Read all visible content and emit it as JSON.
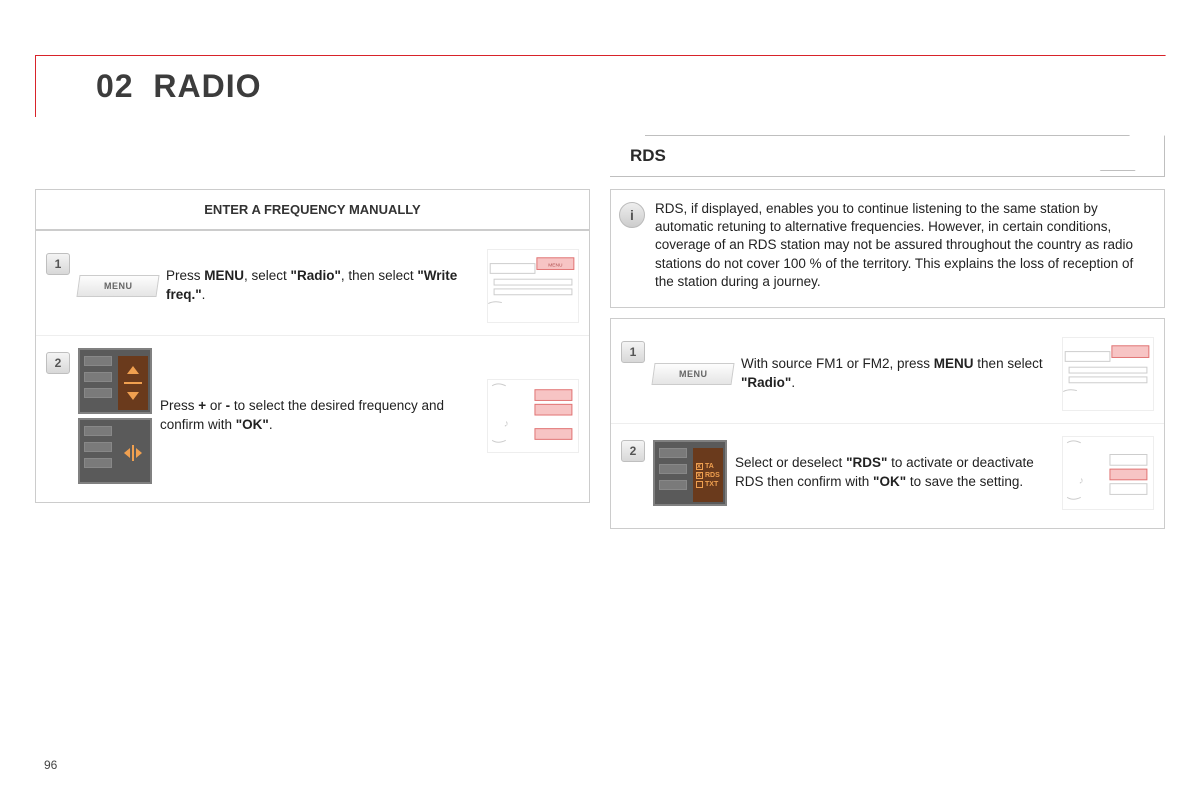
{
  "page": {
    "section_number": "02",
    "section_title": "RADIO",
    "page_number": "96"
  },
  "left": {
    "heading": "ENTER A FREQUENCY MANUALLY",
    "step1_num": "1",
    "step1_btn": "MENU",
    "step1_text_a": "Press ",
    "step1_text_b": "MENU",
    "step1_text_c": ", select ",
    "step1_text_d": "\"Radio\"",
    "step1_text_e": ", then select ",
    "step1_text_f": "\"Write freq.\"",
    "step1_text_g": ".",
    "step2_num": "2",
    "step2_text_a": "Press ",
    "step2_text_b": "+",
    "step2_text_c": " or ",
    "step2_text_d": "-",
    "step2_text_e": " to select the desired frequency and confirm with ",
    "step2_text_f": "\"OK\"",
    "step2_text_g": "."
  },
  "right": {
    "heading": "RDS",
    "info_badge": "i",
    "info_text": "RDS, if displayed, enables you to continue listening to the same station by automatic retuning to alternative frequencies. However, in certain conditions, coverage of an RDS station may not be assured throughout the country as radio stations do not cover 100 % of the territory. This explains the loss of reception of the station during a journey.",
    "step1_num": "1",
    "step1_btn": "MENU",
    "step1_text_a": "With source FM1 or FM2, press ",
    "step1_text_b": "MENU",
    "step1_text_c": " then select ",
    "step1_text_d": "\"Radio\"",
    "step1_text_e": ".",
    "step2_num": "2",
    "step2_labels": {
      "ta": "TA",
      "rds": "RDS",
      "txt": "TXT"
    },
    "step2_text_a": "Select or deselect ",
    "step2_text_b": "\"RDS\"",
    "step2_text_c": " to activate or deactivate RDS then confirm with ",
    "step2_text_d": "\"OK\"",
    "step2_text_e": " to save the setting."
  },
  "diagram_labels": {
    "menu": "MENU"
  }
}
